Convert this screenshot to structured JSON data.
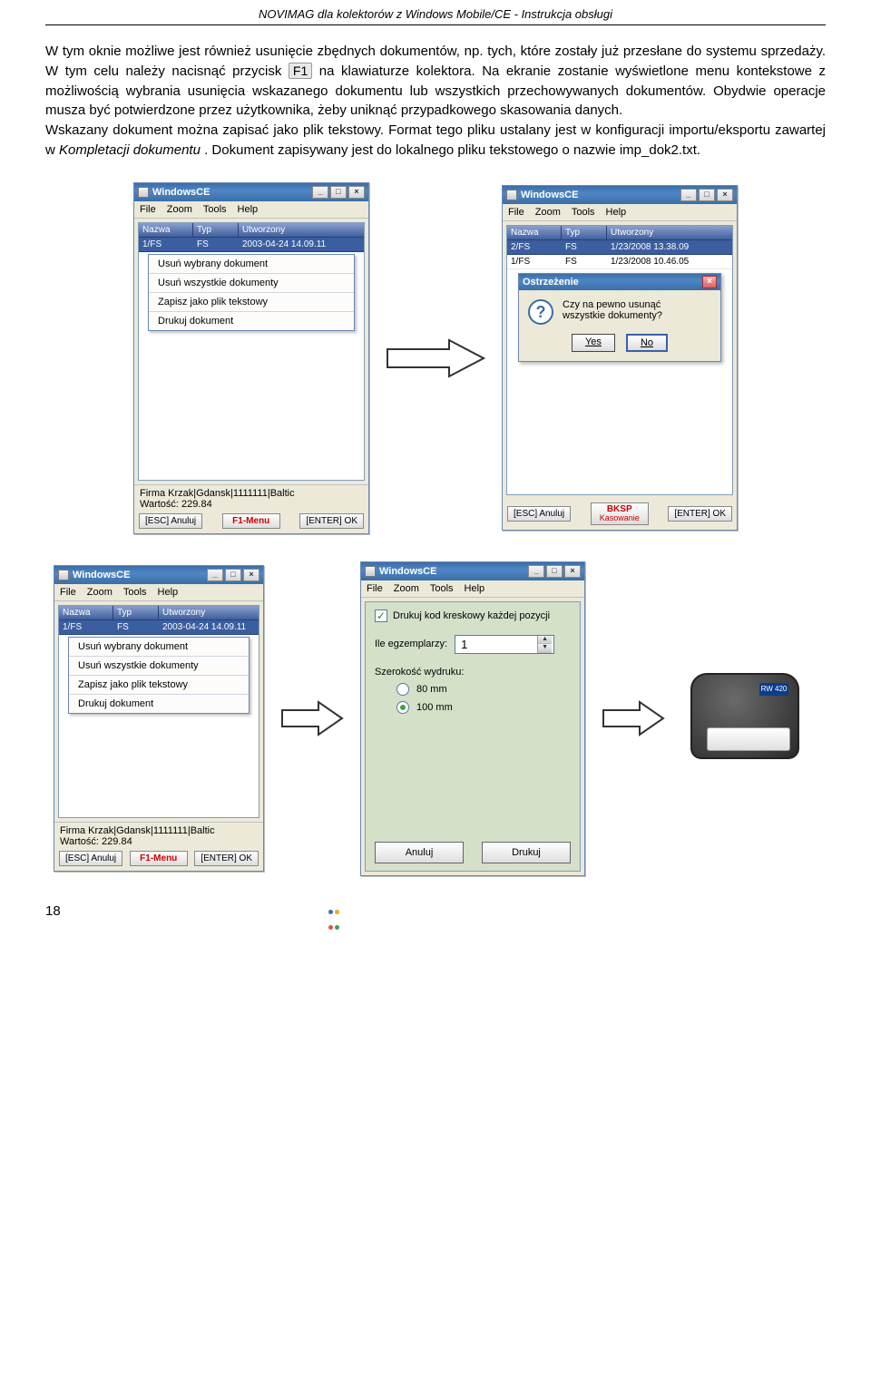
{
  "header": "NOVIMAG dla kolektorów z Windows Mobile/CE - Instrukcja obsługi",
  "paragraph_parts": {
    "p1a": "W tym oknie możliwe jest również usunięcie zbędnych dokumentów, np. tych, które zostały już przesłane do systemu sprzedaży. W tym celu należy nacisnąć przycisk ",
    "p1_key": "F1",
    "p1b": " na klawiaturze kolektora. Na ekranie zostanie wyświetlone menu kontekstowe z możliwością wybrania usunięcia wskazanego dokumentu lub wszystkich przechowywanych dokumentów. Obydwie operacje musza być potwierdzone przez użytkownika, żeby uniknąć przypadkowego skasowania danych.",
    "p2a": "Wskazany dokument można zapisać jako plik tekstowy. Format tego pliku ustalany jest w konfiguracji importu/eksportu zawartej w ",
    "p2_ital": "Kompletacji dokumentu",
    "p2b": ". Dokument zapisywany jest do lokalnego pliku tekstowego o nazwie imp_dok2.txt."
  },
  "win_title": "WindowsCE",
  "win_btns": {
    "min": "_",
    "max": "□",
    "close": "×"
  },
  "menu": [
    "File",
    "Zoom",
    "Tools",
    "Help"
  ],
  "tbl_headers": {
    "name": "Nazwa",
    "type": "Typ",
    "created": "Utworzony"
  },
  "row1": {
    "name": "1/FS",
    "type": "FS",
    "created": "2003-04-24 14.09.11"
  },
  "rows2": [
    {
      "name": "2/FS",
      "type": "FS",
      "created": "1/23/2008 13.38.09"
    },
    {
      "name": "1/FS",
      "type": "FS",
      "created": "1/23/2008 10.46.05"
    }
  ],
  "ctx_items": [
    "Usuń wybrany dokument",
    "Usuń wszystkie dokumenty",
    "Zapisz jako plik tekstowy",
    "Drukuj dokument"
  ],
  "footer_info_line1": "Firma Krzak|Gdansk|1111111|Baltic",
  "footer_info_line2": "Wartość: 229.84",
  "btns": {
    "esc": "[ESC] Anuluj",
    "f1": "F1-Menu",
    "bksp1": "BKSP",
    "bksp2": "Kasowanie",
    "enter": "[ENTER] OK"
  },
  "dialog": {
    "title": "Ostrzeżenie",
    "text1": "Czy na pewno usunąć",
    "text2": "wszystkie dokumenty?",
    "yes": "Yes",
    "no": "No"
  },
  "print": {
    "chk": "Drukuj kod kreskowy każdej pozycji",
    "copies_label": "Ile egzemplarzy:",
    "copies_value": "1",
    "width_label": "Szerokość wydruku:",
    "opt80": "80 mm",
    "opt100": "100 mm",
    "cancel": "Anuluj",
    "print": "Drukuj"
  },
  "printer_badge": "RW 420",
  "page_number": "18"
}
